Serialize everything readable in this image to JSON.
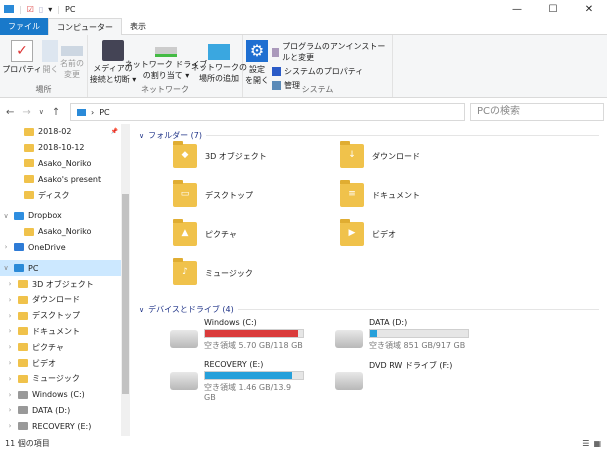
{
  "window": {
    "title": "PC"
  },
  "tabs": [
    {
      "label": "ファイル"
    },
    {
      "label": "コンピューター"
    },
    {
      "label": "表示"
    }
  ],
  "ribbon": {
    "location": {
      "label": "場所",
      "items": [
        {
          "label": "プロパティ"
        },
        {
          "label": "開く"
        },
        {
          "label": "名前の\n変更"
        }
      ]
    },
    "network": {
      "label": "ネットワーク",
      "items": [
        {
          "label": "メディアの\n接続と切断 ▾"
        },
        {
          "label": "ネットワーク ドライブ\nの割り当て ▾"
        },
        {
          "label": "ネットワークの\n場所の追加"
        }
      ]
    },
    "system": {
      "label": "システム",
      "settings": "設定\nを開く",
      "items": [
        {
          "label": "プログラムのアンインストールと変更"
        },
        {
          "label": "システムのプロパティ"
        },
        {
          "label": "管理"
        }
      ]
    }
  },
  "address": {
    "path": "PC",
    "search_placeholder": "PCの検索"
  },
  "sidebar": {
    "items": [
      {
        "label": "2018-02",
        "type": "folder",
        "pin": true
      },
      {
        "label": "2018-10-12",
        "type": "folder"
      },
      {
        "label": "Asako_Noriko",
        "type": "folder"
      },
      {
        "label": "Asako's present",
        "type": "folder"
      },
      {
        "label": "ディスク",
        "type": "folder"
      },
      {
        "label": "",
        "type": "gap"
      },
      {
        "label": "Dropbox",
        "type": "dropbox"
      },
      {
        "label": "Asako_Noriko",
        "type": "folder"
      },
      {
        "label": "OneDrive",
        "type": "cloud"
      },
      {
        "label": "",
        "type": "gap"
      },
      {
        "label": "PC",
        "type": "pc",
        "selected": true
      },
      {
        "label": "3D オブジェクト",
        "type": "folder"
      },
      {
        "label": "ダウンロード",
        "type": "folder"
      },
      {
        "label": "デスクトップ",
        "type": "folder"
      },
      {
        "label": "ドキュメント",
        "type": "folder"
      },
      {
        "label": "ピクチャ",
        "type": "folder"
      },
      {
        "label": "ビデオ",
        "type": "folder"
      },
      {
        "label": "ミュージック",
        "type": "folder"
      },
      {
        "label": "Windows (C:)",
        "type": "drive"
      },
      {
        "label": "DATA (D:)",
        "type": "drive"
      },
      {
        "label": "RECOVERY (E:)",
        "type": "drive"
      }
    ]
  },
  "folders": {
    "header": "フォルダー (7)",
    "items": [
      {
        "label": "3D オブジェクト",
        "icon": "◆"
      },
      {
        "label": "ダウンロード",
        "icon": "↓"
      },
      {
        "label": "デスクトップ",
        "icon": "▭"
      },
      {
        "label": "ドキュメント",
        "icon": "≡"
      },
      {
        "label": "ピクチャ",
        "icon": "▲"
      },
      {
        "label": "ビデオ",
        "icon": "▶"
      },
      {
        "label": "ミュージック",
        "icon": "♪"
      }
    ]
  },
  "drives": {
    "header": "デバイスとドライブ (4)",
    "items": [
      {
        "label": "Windows (C:)",
        "free": "空き領域 5.70 GB/118 GB",
        "used_pct": 95,
        "color": "#da3b3b"
      },
      {
        "label": "DATA (D:)",
        "free": "空き領域 851 GB/917 GB",
        "used_pct": 7,
        "color": "#26a0da"
      },
      {
        "label": "RECOVERY (E:)",
        "free": "空き領域 1.46 GB/13.9 GB",
        "used_pct": 89,
        "color": "#26a0da"
      },
      {
        "label": "DVD RW ドライブ (F:)",
        "free": null,
        "used_pct": null
      }
    ]
  },
  "status": {
    "count": "11 個の項目"
  }
}
